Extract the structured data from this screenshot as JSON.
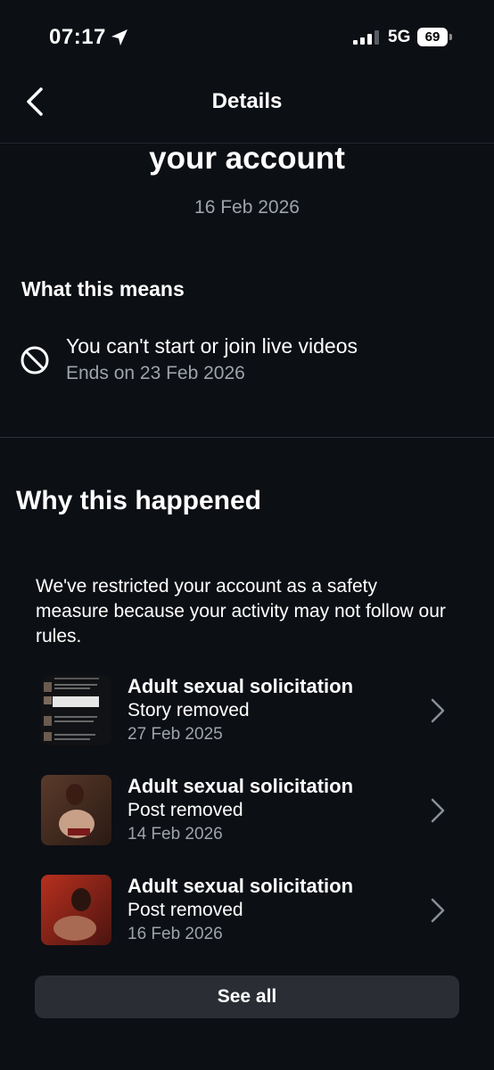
{
  "status_bar": {
    "time": "07:17",
    "network": "5G",
    "battery": "69"
  },
  "nav": {
    "title": "Details"
  },
  "header": {
    "title": "your account",
    "date": "16 Feb 2026"
  },
  "what_this_means": {
    "title": "What this means",
    "restriction": "You can't start or join live videos",
    "ends": "Ends on 23 Feb 2026",
    "icon": "ban-icon"
  },
  "why": {
    "title": "Why this happened",
    "description": "We've restricted your account as a safety measure because your activity may not follow our rules.",
    "violations": [
      {
        "title": "Adult sexual solicitation",
        "type": "Story removed",
        "date": "27 Feb 2025"
      },
      {
        "title": "Adult sexual solicitation",
        "type": "Post removed",
        "date": "14 Feb 2026"
      },
      {
        "title": "Adult sexual solicitation",
        "type": "Post removed",
        "date": "16 Feb 2026"
      }
    ]
  },
  "see_all_label": "See all",
  "colors": {
    "background": "#0c0f14",
    "secondary_text": "#9ea3ab",
    "button": "#2a2d33"
  }
}
